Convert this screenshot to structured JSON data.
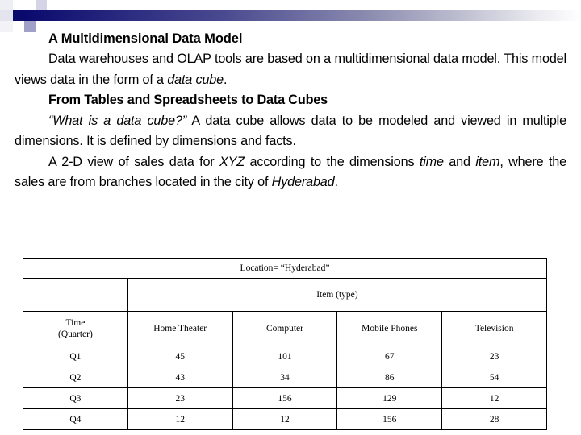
{
  "slide": {
    "title": "A Multidimensional Data Model",
    "paragraph1_part1": "Data warehouses and OLAP tools are based on a multidimensional data model. This model views data in the form of a ",
    "paragraph1_italic": "data cube",
    "paragraph1_part2": ".",
    "subheading": "From Tables and Spreadsheets to Data Cubes",
    "paragraph2_quote": "“What is a data cube?”",
    "paragraph2_rest": " A data cube allows data to be modeled and viewed in multiple dimensions. It is defined by dimensions and facts.",
    "paragraph3_a": "A 2-D view of sales data for ",
    "paragraph3_xyz": "XYZ",
    "paragraph3_b": " according to the dimensions ",
    "paragraph3_time": "time",
    "paragraph3_c": " and ",
    "paragraph3_item": "item",
    "paragraph3_d": ", where the sales are from branches located in the city of ",
    "paragraph3_city": "Hyderabad",
    "paragraph3_e": "."
  },
  "decoration": {
    "accent_dark": "#0a0a6e",
    "accent_mid": "#4a4a90",
    "accent_light": "#b7b7d4",
    "accent_pale": "#d9d9e8"
  },
  "table": {
    "location_header": "Location= “Hyderabad”",
    "item_header": "Item (type)",
    "time_header_line1": "Time",
    "time_header_line2": "(Quarter)",
    "columns": [
      "Home Theater",
      "Computer",
      "Mobile Phones",
      "Television"
    ],
    "rows": [
      {
        "quarter": "Q1",
        "values": [
          "45",
          "101",
          "67",
          "23"
        ]
      },
      {
        "quarter": "Q2",
        "values": [
          "43",
          "34",
          "86",
          "54"
        ]
      },
      {
        "quarter": "Q3",
        "values": [
          "23",
          "156",
          "129",
          "12"
        ]
      },
      {
        "quarter": "Q4",
        "values": [
          "12",
          "12",
          "156",
          "28"
        ]
      }
    ]
  }
}
